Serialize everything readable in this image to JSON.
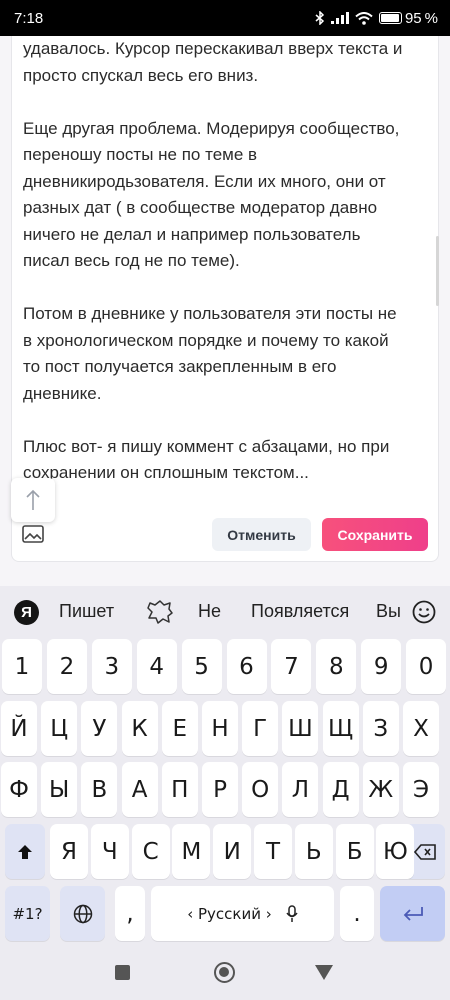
{
  "status_bar": {
    "time": "7:18",
    "battery": "95",
    "battery_level": 0.95
  },
  "editor": {
    "lines": [
      "удавалось. Курсор перескакивал вверх текста и",
      "просто спускал весь его вниз.",
      "",
      "Еще другая проблема. Модерируя сообщество,",
      "переношу посты не по теме в",
      "дневникиродьзователя. Если их много, они от",
      "разных дат ( в сообществе модератор давно",
      "ничего не делал и например пользователь",
      "писал весь год не по теме).",
      "",
      "Потом в дневнике у пользователя эти посты не",
      "в хронологическом порядке и почему то какой",
      "то пост получается закрепленным в его",
      "дневнике.",
      "",
      "Плюс вот- я пишу коммент с абзацами, но при",
      "сохранении он сплошным текстом..."
    ],
    "cancel_label": "Отменить",
    "save_label": "Сохранить",
    "save_gradient": [
      "#f7517c",
      "#ef3f8a"
    ]
  },
  "keyboard": {
    "logo": "Я",
    "suggestions": [
      "Пишет",
      "Не",
      "Появляется",
      "Вы"
    ],
    "number_row": [
      "1",
      "2",
      "3",
      "4",
      "5",
      "6",
      "7",
      "8",
      "9",
      "0"
    ],
    "row1": [
      "Й",
      "Ц",
      "У",
      "К",
      "Е",
      "Н",
      "Г",
      "Ш",
      "Щ",
      "З",
      "Х"
    ],
    "row2": [
      "Ф",
      "Ы",
      "В",
      "А",
      "П",
      "Р",
      "О",
      "Л",
      "Д",
      "Ж",
      "Э"
    ],
    "row3": [
      "Я",
      "Ч",
      "С",
      "М",
      "И",
      "Т",
      "Ь",
      "Б",
      "Ю"
    ],
    "symbols_label": "#1?",
    "comma": ",",
    "period": ".",
    "space_label": "‹ Русский ›"
  }
}
